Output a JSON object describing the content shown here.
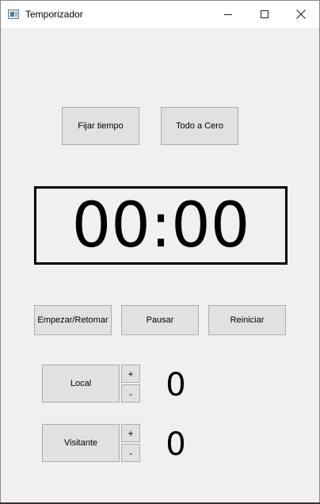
{
  "window": {
    "title": "Temporizador",
    "controls": {
      "minimize": "minimize-icon",
      "maximize": "maximize-icon",
      "close": "close-icon"
    }
  },
  "top_buttons": {
    "set_time": "Fijar tiempo",
    "reset_all": "Todo a Cero"
  },
  "timer": {
    "display": "00:00"
  },
  "controls": {
    "start": "Empezar/Retomar",
    "pause": "Pausar",
    "restart": "Reiniciar"
  },
  "teams": {
    "local": {
      "label": "Local",
      "plus": "+",
      "minus": "-",
      "score": "0"
    },
    "visitor": {
      "label": "Visitante",
      "plus": "+",
      "minus": "-",
      "score": "0"
    }
  },
  "colors": {
    "background": "#f0f0f0",
    "button": "#e1e1e1",
    "button_border": "#adadad"
  }
}
